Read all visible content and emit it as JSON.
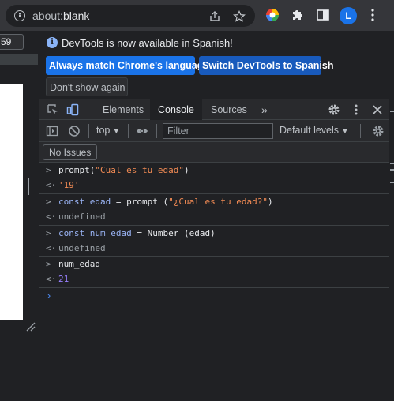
{
  "browser": {
    "url_scheme": "about:",
    "url_host": "blank",
    "avatar_letter": "L"
  },
  "page": {
    "left_input_value": "59"
  },
  "infobar": {
    "message": "DevTools is now available in Spanish!",
    "btn_match": "Always match Chrome's language",
    "btn_switch": "Switch DevTools to Spanish",
    "btn_dismiss": "Don't show again"
  },
  "tabs": {
    "elements": "Elements",
    "console": "Console",
    "sources": "Sources",
    "more": "»"
  },
  "toolbar": {
    "context": "top",
    "filter_placeholder": "Filter",
    "levels": "Default levels"
  },
  "issues": {
    "label": "No Issues"
  },
  "console": {
    "entries": [
      {
        "input": {
          "pre": "prompt(",
          "str": "\"Cual es tu edad\"",
          "post": ")"
        },
        "output": "'19'"
      },
      {
        "input": {
          "kw": "const",
          "var": "edad",
          "mid": " = prompt (",
          "str": "\"¿Cual es tu edad?\"",
          "post": ")"
        },
        "output": "undefined"
      },
      {
        "input": {
          "kw": "const",
          "var": "num_edad",
          "mid": " = Number (edad)"
        },
        "output": "undefined"
      },
      {
        "input": {
          "plain": "num_edad"
        },
        "output": "21"
      }
    ]
  },
  "colors": {
    "accent": "#1a73e8",
    "string": "#f28b54",
    "keyword": "#9ab4f5",
    "number": "#9980ff"
  }
}
